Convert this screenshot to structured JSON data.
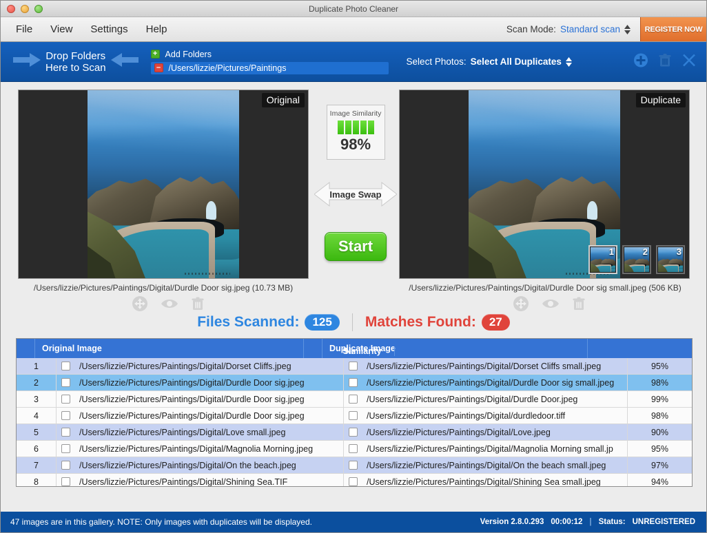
{
  "window": {
    "title": "Duplicate Photo Cleaner"
  },
  "menu": {
    "items": [
      {
        "label": "File",
        "name": "menu-file"
      },
      {
        "label": "View",
        "name": "menu-view"
      },
      {
        "label": "Settings",
        "name": "menu-settings"
      },
      {
        "label": "Help",
        "name": "menu-help"
      }
    ],
    "scan_mode_label": "Scan Mode:",
    "scan_mode_value": "Standard scan",
    "register_label": "REGISTER NOW"
  },
  "toolbar": {
    "drop_line1": "Drop Folders",
    "drop_line2": "Here to Scan",
    "add_folders_label": "Add Folders",
    "add_folders_sign": "+",
    "folder_path": "/Users/lizzie/Pictures/Paintings",
    "folder_remove_sign": "–",
    "select_photos_label": "Select Photos:",
    "select_photos_value": "Select All Duplicates"
  },
  "compare": {
    "left": {
      "badge": "Original",
      "caption": "/Users/lizzie/Pictures/Paintings/Digital/Durdle Door sig.jpeg (10.73 MB)"
    },
    "right": {
      "badge": "Duplicate",
      "caption": "/Users/lizzie/Pictures/Paintings/Digital/Durdle Door sig small.jpeg (506 KB)",
      "thumbnails": [
        "1",
        "2",
        "3"
      ],
      "selected_thumbnail": "1"
    },
    "similarity": {
      "title": "Image Similarity",
      "percent": "98%",
      "bars_filled": 5,
      "bar_color": "#3bbf10"
    },
    "swap_label": "Image Swap",
    "start_label": "Start"
  },
  "stats": {
    "files_scanned_label": "Files Scanned:",
    "files_scanned_value": "125",
    "matches_found_label": "Matches Found:",
    "matches_found_value": "27",
    "blue": "#2e86e0",
    "red": "#e0443b"
  },
  "table": {
    "columns": [
      "№",
      "",
      "Original Image",
      "",
      "Duplicate Image",
      "Similarity"
    ],
    "rows": [
      {
        "num": "1",
        "original": "/Users/lizzie/Pictures/Paintings/Digital/Dorset Cliffs.jpeg",
        "duplicate": "/Users/lizzie/Pictures/Paintings/Digital/Dorset Cliffs small.jpeg",
        "similarity": "95%",
        "style": "alt"
      },
      {
        "num": "2",
        "original": "/Users/lizzie/Pictures/Paintings/Digital/Durdle Door sig.jpeg",
        "duplicate": "/Users/lizzie/Pictures/Paintings/Digital/Durdle Door sig small.jpeg",
        "similarity": "98%",
        "style": "selected"
      },
      {
        "num": "3",
        "original": "/Users/lizzie/Pictures/Paintings/Digital/Durdle Door sig.jpeg",
        "duplicate": "/Users/lizzie/Pictures/Paintings/Digital/Durdle Door.jpeg",
        "similarity": "99%",
        "style": "plain"
      },
      {
        "num": "4",
        "original": "/Users/lizzie/Pictures/Paintings/Digital/Durdle Door sig.jpeg",
        "duplicate": "/Users/lizzie/Pictures/Paintings/Digital/durdledoor.tiff",
        "similarity": "98%",
        "style": "plain"
      },
      {
        "num": "5",
        "original": "/Users/lizzie/Pictures/Paintings/Digital/Love small.jpeg",
        "duplicate": "/Users/lizzie/Pictures/Paintings/Digital/Love.jpeg",
        "similarity": "90%",
        "style": "alt"
      },
      {
        "num": "6",
        "original": "/Users/lizzie/Pictures/Paintings/Digital/Magnolia Morning.jpeg",
        "duplicate": "/Users/lizzie/Pictures/Paintings/Digital/Magnolia Morning small.jp",
        "similarity": "95%",
        "style": "plain"
      },
      {
        "num": "7",
        "original": "/Users/lizzie/Pictures/Paintings/Digital/On the beach.jpeg",
        "duplicate": "/Users/lizzie/Pictures/Paintings/Digital/On the beach small.jpeg",
        "similarity": "97%",
        "style": "alt"
      },
      {
        "num": "8",
        "original": "/Users/lizzie/Pictures/Paintings/Digital/Shining Sea.TIF",
        "duplicate": "/Users/lizzie/Pictures/Paintings/Digital/Shining Sea small.jpeg",
        "similarity": "94%",
        "style": "plain"
      }
    ]
  },
  "status": {
    "message": "47 images are in this gallery. NOTE: Only images with duplicates will be displayed.",
    "version": "Version 2.8.0.293",
    "elapsed": "00:00:12",
    "separator": "|",
    "status_label": "Status:",
    "status_value": "UNREGISTERED"
  }
}
